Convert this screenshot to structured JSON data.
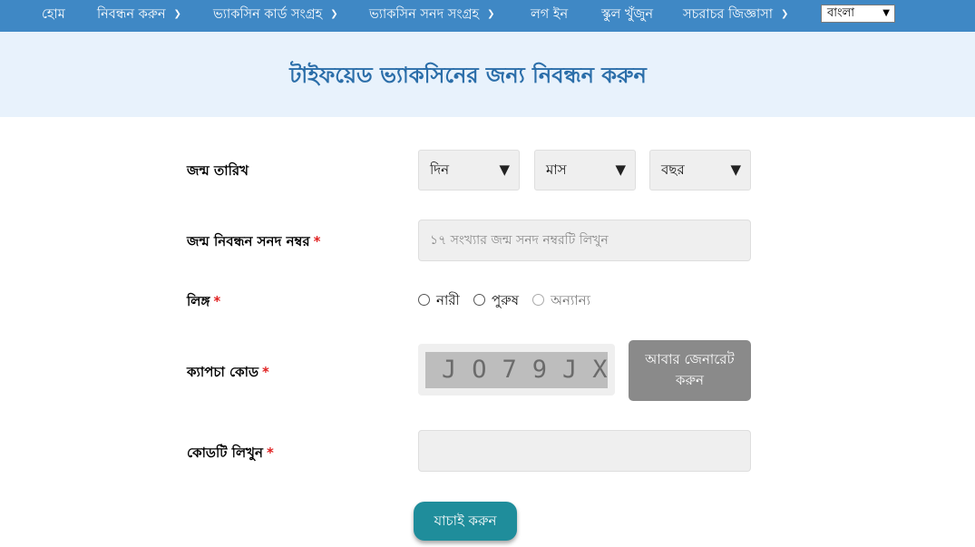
{
  "nav": {
    "items": [
      {
        "label": "হোম",
        "dropdown": false
      },
      {
        "label": "নিবন্ধন করুন",
        "dropdown": true
      },
      {
        "label": "ভ্যাকসিন কার্ড সংগ্রহ",
        "dropdown": true
      },
      {
        "label": "ভ্যাকসিন সনদ সংগ্রহ",
        "dropdown": true
      },
      {
        "label": "লগ ইন",
        "dropdown": false
      },
      {
        "label": "স্কুল খুঁজুন",
        "dropdown": false
      },
      {
        "label": "সচরাচর জিজ্ঞাসা",
        "dropdown": true
      }
    ],
    "language": "বাংলা"
  },
  "page": {
    "title": "টাইফয়েড ভ্যাকসিনের জন্য নিবন্ধন করুন"
  },
  "form": {
    "dob_label": "জন্ম তারিখ",
    "day": "দিন",
    "month": "মাস",
    "year": "বছর",
    "brn_label": "জন্ম নিবন্ধন সনদ নম্বর",
    "brn_placeholder": "১৭ সংখ্যার জন্ম সনদ নম্বরটি লিখুন",
    "gender_label": "লিঙ্গ",
    "gender_options": [
      "নারী",
      "পুরুষ",
      "অন্যান্য"
    ],
    "captcha_label": "ক্যাপচা কোড",
    "captcha_code": "JO79JX",
    "regen_line1": "আবার জেনারেট",
    "regen_line2": "করুন",
    "code_label": "কোডটি লিখুন",
    "required_mark": "*",
    "submit": "যাচাই করুন"
  },
  "colors": {
    "nav_bg": "#3f88c5",
    "banner_bg": "#e8f2fc",
    "title": "#2b6ea9",
    "required": "#e02020",
    "submit_bg": "#1f8d9b"
  }
}
